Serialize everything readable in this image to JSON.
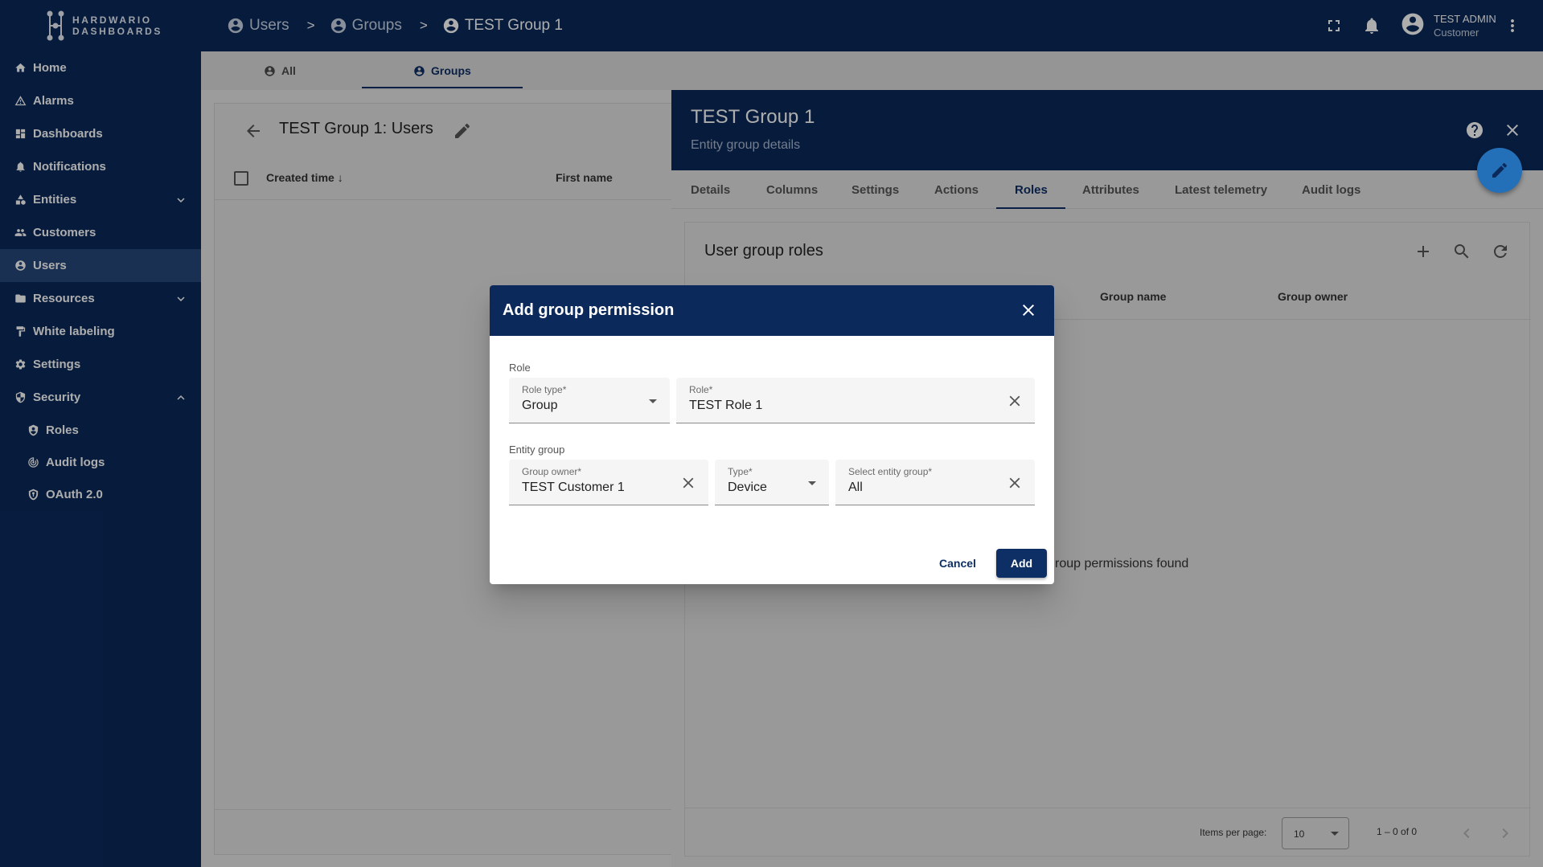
{
  "app": {
    "logo_line1": "HARDWARIO",
    "logo_line2": "DASHBOARDS"
  },
  "sidebar": {
    "items": [
      {
        "label": "Home",
        "icon": "home-icon"
      },
      {
        "label": "Alarms",
        "icon": "warning-icon"
      },
      {
        "label": "Dashboards",
        "icon": "dashboard-icon"
      },
      {
        "label": "Notifications",
        "icon": "notification-icon"
      },
      {
        "label": "Entities",
        "icon": "entities-icon",
        "expandable": true
      },
      {
        "label": "Customers",
        "icon": "people-icon"
      },
      {
        "label": "Users",
        "icon": "account-icon",
        "active": true
      },
      {
        "label": "Resources",
        "icon": "folder-icon",
        "expandable": true
      },
      {
        "label": "White labeling",
        "icon": "paint-roller-icon"
      },
      {
        "label": "Settings",
        "icon": "gear-icon"
      },
      {
        "label": "Security",
        "icon": "shield-icon",
        "expanded": true
      },
      {
        "label": "Roles",
        "icon": "role-icon"
      },
      {
        "label": "Audit logs",
        "icon": "track-changes-icon"
      },
      {
        "label": "OAuth 2.0",
        "icon": "security-icon"
      }
    ]
  },
  "header": {
    "breadcrumbs": [
      "Users",
      "Groups",
      "TEST Group 1"
    ],
    "separator": ">",
    "user_name": "TEST ADMIN",
    "user_role": "Customer"
  },
  "top_tabs": {
    "all": "All",
    "groups": "Groups"
  },
  "left_panel": {
    "title": "TEST Group 1: Users",
    "columns": {
      "created_time": "Created time",
      "first_name": "First name"
    }
  },
  "right_panel": {
    "title": "TEST Group 1",
    "subtitle": "Entity group details",
    "tabs": [
      "Details",
      "Columns",
      "Settings",
      "Actions",
      "Roles",
      "Attributes",
      "Latest telemetry",
      "Audit logs"
    ],
    "active_tab": "Roles",
    "card_title": "User group roles",
    "columns": {
      "group_name": "Group name",
      "group_owner": "Group owner"
    },
    "empty_text": "roup permissions found",
    "items_per_page_label": "Items per page:",
    "items_per_page": "10",
    "range": "1 – 0 of 0"
  },
  "dialog": {
    "title": "Add group permission",
    "role_section": "Role",
    "role_type": {
      "label": "Role type*",
      "value": "Group"
    },
    "role": {
      "label": "Role*",
      "value": "TEST Role 1"
    },
    "entity_group_section": "Entity group",
    "group_owner": {
      "label": "Group owner*",
      "value": "TEST Customer 1"
    },
    "type": {
      "label": "Type*",
      "value": "Device"
    },
    "select_entity_group": {
      "label": "Select entity group*",
      "value": "All"
    },
    "cancel": "Cancel",
    "add": "Add"
  },
  "colors": {
    "primary": "#0b2a5b",
    "accent": "#2470b8"
  }
}
